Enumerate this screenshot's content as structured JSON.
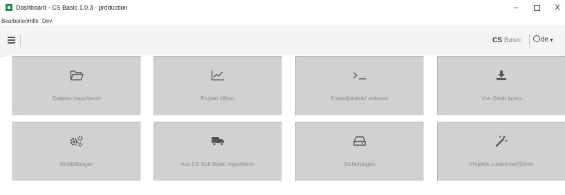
{
  "window": {
    "title": "Dashboard - CS Basic 1.0.3 - production",
    "minimize_glyph": "–",
    "close_glyph": "X"
  },
  "menu": {
    "items": [
      {
        "label": "Bearbeiten"
      },
      {
        "label": "Hilfe"
      },
      {
        "label": "Dev"
      }
    ]
  },
  "toolbar": {
    "brand_bold": "CS",
    "brand_light": "Basic",
    "language": "de"
  },
  "tiles": [
    {
      "label": "Dateien importieren",
      "icon": "folder-open-icon"
    },
    {
      "label": "Projekt öffnen",
      "icon": "line-chart-icon"
    },
    {
      "label": "Embeddedatei einlesen",
      "icon": "terminal-icon"
    },
    {
      "label": "Von Gerät laden",
      "icon": "download-icon"
    },
    {
      "label": "Einstellungen",
      "icon": "cogs-icon"
    },
    {
      "label": "Aus CS Soft Basic importieren",
      "icon": "truck-icon"
    },
    {
      "label": "Sicherungen",
      "icon": "hdd-icon"
    },
    {
      "label": "Projekte zusammenführen",
      "icon": "magic-wand-icon"
    }
  ],
  "colors": {
    "tile_background": "#d1d1d1",
    "tile_label": "#8c8c8c",
    "app_icon_green": "#1f8a4c"
  }
}
